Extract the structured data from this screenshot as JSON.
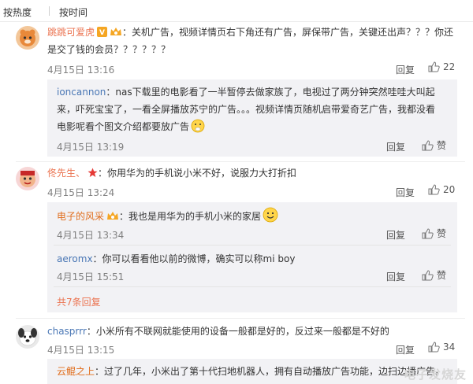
{
  "sort_bar": {
    "hot_label": "按热度",
    "time_label": "按时间"
  },
  "comments": [
    {
      "username": "跳跳可爱虎",
      "badge_vip": "V",
      "text_line1": "：关机广告，视频详情页右下角还有广告，屏保带广告，关键还出声？？？你还",
      "text_line2": "是交了钱的会员？？？？？？",
      "time": "4月15日 13:16",
      "reply_label": "回复",
      "likes": "22",
      "replies": [
        {
          "username": "ioncannon",
          "text_line1": "：nas下载里的电影看了一半暂停去做家族了，电视过了两分钟突然哇哇大叫起",
          "text_line2": "来，吓死宝宝了，一看全屏播放苏宁的广告。。。视频详情页随机启带爱奇艺广告，我都没看",
          "text_line3": "电影呢看个图文介绍都要放广告",
          "time": "4月15日 13:19",
          "reply_label": "回复",
          "like_label": "赞"
        }
      ]
    },
    {
      "username": "佟先生、",
      "text_line1": "：你用华为的手机说小米不好，说服力大打折扣",
      "time": "4月15日 13:24",
      "reply_label": "回复",
      "likes": "20",
      "replies": [
        {
          "username": "电子的风采",
          "text_line1": "：我也是用华为的手机小米的家居",
          "time": "4月15日 13:34",
          "reply_label": "回复",
          "like_label": "赞"
        },
        {
          "username": "aeromx",
          "text_line1": "：你可以看看他以前的微博，确实可以称mi boy",
          "time": "4月15日 15:51",
          "reply_label": "回复",
          "like_label": "赞"
        }
      ],
      "more_replies": "共7条回复"
    },
    {
      "username": "chasprrr",
      "text_line1": "：小米所有不联网就能使用的设备一般都是好的，反过来一般都是不好的",
      "time": "4月15日 13:15",
      "reply_label": "回复",
      "likes": "34",
      "replies": [
        {
          "username": "云鲲之上",
          "text_line1": "：过了几年，小米出了第十代扫地机器人，拥有自动播放广告功能，边扫边播广告。"
        }
      ]
    }
  ],
  "watermark": "电子发烧友",
  "colors": {
    "username": "#eb7350",
    "reply_bg": "#f2f2f5",
    "muted": "#808080"
  }
}
